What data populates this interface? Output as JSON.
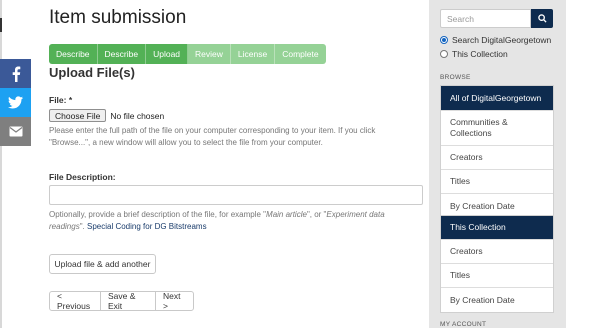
{
  "page": {
    "title": "Item submission",
    "steps": [
      {
        "label": "Describe",
        "state": "done"
      },
      {
        "label": "Describe",
        "state": "done"
      },
      {
        "label": "Upload",
        "state": "done"
      },
      {
        "label": "Review",
        "state": "todo"
      },
      {
        "label": "License",
        "state": "todo"
      },
      {
        "label": "Complete",
        "state": "todo"
      }
    ],
    "section_title": "Upload File(s)",
    "file": {
      "label": "File: *",
      "choose_label": "Choose File",
      "status": "No file chosen",
      "help_line1": "Please enter the full path of the file on your computer corresponding to your item. If you click",
      "help_line2": "\"Browse...\", a new window will allow you to select the file from your computer."
    },
    "description": {
      "label": "File Description:",
      "value": "",
      "help_a": "Optionally, provide a brief description of the file, for example \"",
      "help_em1": "Main article",
      "help_b": "\", or \"",
      "help_em2": "Experiment data",
      "help_em3": "readings",
      "help_c": "\". ",
      "help_link": "Special Coding for DG Bitstreams"
    },
    "upload_another_label": "Upload file & add another",
    "nav_buttons": {
      "previous": "< Previous",
      "save_exit": "Save & Exit",
      "next": "Next >"
    }
  },
  "sidebar": {
    "search_placeholder": "Search",
    "scope_options": [
      {
        "label": "Search DigitalGeorgetown",
        "selected": true
      },
      {
        "label": "This Collection",
        "selected": false
      }
    ],
    "browse_heading": "BROWSE",
    "global_nav": {
      "header": "All of DigitalGeorgetown",
      "items": [
        "Communities &",
        "Collections",
        "Creators",
        "Titles",
        "By Creation Date"
      ]
    },
    "collection_nav": {
      "header": "This Collection",
      "items": [
        "Creators",
        "Titles",
        "By Creation Date"
      ]
    },
    "account_heading": "MY ACCOUNT"
  },
  "social": [
    "facebook-icon",
    "twitter-icon",
    "email-icon"
  ],
  "colors": {
    "step_done": "#53b156",
    "step_todo": "#95d296",
    "nav_active": "#0e2b4e",
    "link": "#1a3c6b",
    "facebook": "#3b5998",
    "twitter": "#1da1f2"
  }
}
